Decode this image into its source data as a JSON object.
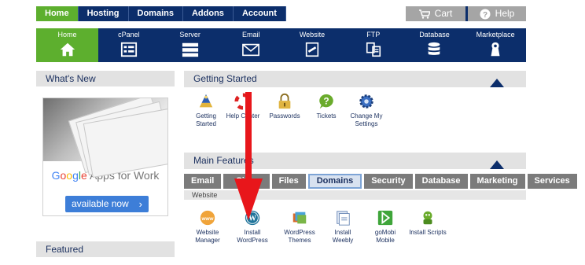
{
  "topnav": {
    "tabs": [
      {
        "label": "Home",
        "active": true
      },
      {
        "label": "Hosting",
        "active": false
      },
      {
        "label": "Domains",
        "active": false
      },
      {
        "label": "Addons",
        "active": false
      },
      {
        "label": "Account",
        "active": false
      }
    ],
    "cart_label": "Cart",
    "help_label": "Help"
  },
  "iconbar": {
    "items": [
      {
        "label": "Home",
        "icon": "house-icon"
      },
      {
        "label": "cPanel",
        "icon": "cpanel-icon"
      },
      {
        "label": "Server",
        "icon": "server-icon"
      },
      {
        "label": "Email",
        "icon": "envelope-icon"
      },
      {
        "label": "Website",
        "icon": "website-icon"
      },
      {
        "label": "FTP",
        "icon": "ftp-icon"
      },
      {
        "label": "Database",
        "icon": "database-icon"
      },
      {
        "label": "Marketplace",
        "icon": "marketplace-icon"
      }
    ]
  },
  "left": {
    "whats_new": "What's New",
    "ad": {
      "brand_letters": [
        "G",
        "o",
        "o",
        "g",
        "l",
        "e"
      ],
      "product": "Apps for Work",
      "button": "available now"
    },
    "featured": "Featured"
  },
  "getting_started": {
    "title": "Getting Started",
    "items": [
      {
        "line1": "Getting",
        "line2": "Started",
        "icon": "wizard-icon"
      },
      {
        "line1": "Help Center",
        "line2": "",
        "icon": "lifebuoy-icon"
      },
      {
        "line1": "Passwords",
        "line2": "",
        "icon": "lock-icon"
      },
      {
        "line1": "Tickets",
        "line2": "",
        "icon": "question-bubble-icon"
      },
      {
        "line1": "Change My",
        "line2": "Settings",
        "icon": "gear-icon"
      }
    ]
  },
  "main_features": {
    "title": "Main Features",
    "filters": [
      {
        "label": "Email",
        "selected": false
      },
      {
        "label": "Sites",
        "selected": false
      },
      {
        "label": "Files",
        "selected": false
      },
      {
        "label": "Domains",
        "selected": true
      },
      {
        "label": "Security",
        "selected": false
      },
      {
        "label": "Database",
        "selected": false
      },
      {
        "label": "Marketing",
        "selected": false
      },
      {
        "label": "Services",
        "selected": false
      }
    ],
    "subhead": "Website",
    "items": [
      {
        "line1": "Website",
        "line2": "Manager",
        "icon": "www-icon"
      },
      {
        "line1": "Install",
        "line2": "WordPress",
        "icon": "wordpress-icon"
      },
      {
        "line1": "WordPress",
        "line2": "Themes",
        "icon": "themes-icon"
      },
      {
        "line1": "Install",
        "line2": "Weebly",
        "icon": "weebly-icon"
      },
      {
        "line1": "goMobi",
        "line2": "Mobile",
        "icon": "gomobi-icon"
      },
      {
        "line1": "Install Scripts",
        "line2": "",
        "icon": "scripts-icon"
      }
    ]
  },
  "colors": {
    "navy": "#0c2e6b",
    "green": "#5daf2e",
    "arrow": "#e8161b"
  }
}
